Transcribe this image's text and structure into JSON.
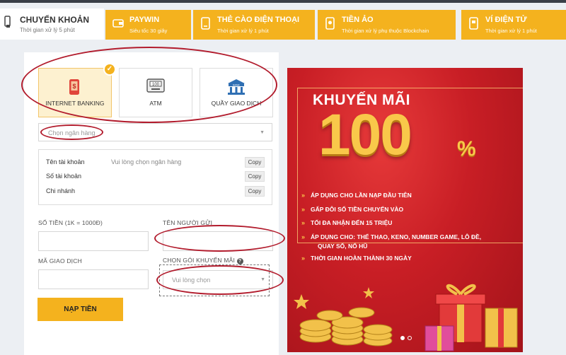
{
  "tabs": {
    "active": {
      "title": "CHUYỂN KHOẢN",
      "subtitle": "Thời gian xử lý 5 phút"
    },
    "items": [
      {
        "title": "PAYWIN",
        "subtitle": "Siêu tốc 30 giây"
      },
      {
        "title": "THẺ CÀO ĐIỆN THOẠI",
        "subtitle": "Thời gian xử lý 1 phút"
      },
      {
        "title": "TIỀN ẢO",
        "subtitle": "Thời gian xử lý phụ thuộc Blockchain"
      },
      {
        "title": "VÍ ĐIỆN TỬ",
        "subtitle": "Thời gian xử lý 1 phút"
      }
    ]
  },
  "methods": [
    {
      "label": "INTERNET BANKING",
      "selected": true
    },
    {
      "label": "ATM",
      "selected": false
    },
    {
      "label": "QUẦY GIAO DỊCH",
      "selected": false
    }
  ],
  "atm_icon_text": "100",
  "bank_icon_text": "BANK",
  "bank_select": {
    "placeholder": "Chọn ngân hàng"
  },
  "account_info": {
    "name_label": "Tên tài khoản",
    "number_label": "Số tài khoản",
    "branch_label": "Chi nhánh",
    "name_value": "Vui lòng chọn ngân hàng",
    "copy_label": "Copy"
  },
  "form": {
    "amount_label": "SỐ TIỀN (1K = 1000Đ)",
    "sender_label": "TÊN NGƯỜI GỬI",
    "txn_label": "MÃ GIAO DỊCH",
    "promo_label": "CHỌN GÓI KHUYẾN MÃI",
    "promo_placeholder": "Vui lòng chọn",
    "help_glyph": "?",
    "submit_label": "NẠP TIỀN"
  },
  "promo_banner": {
    "title": "KHUYẾN MÃI",
    "big_number": "100",
    "percent": "%",
    "lines": [
      "ÁP DỤNG CHO LẦN NẠP ĐẦU TIÊN",
      "GẤP ĐÔI SỐ TIỀN CHUYỂN VÀO",
      "TỐI ĐA NHẬN ĐẾN 15 TRIỆU",
      "ÁP DỤNG CHO: THỂ THAO, KENO, NUMBER GAME, LÔ ĐỀ,",
      "QUAY SỐ, NỔ HŨ",
      "THỜI GIAN HOÀN THÀNH 30 NGÀY"
    ]
  },
  "colors": {
    "accent": "#f4b21e",
    "annotation": "#b21c2d",
    "banner_red": "#c81e25",
    "gold": "#f9c84a"
  }
}
